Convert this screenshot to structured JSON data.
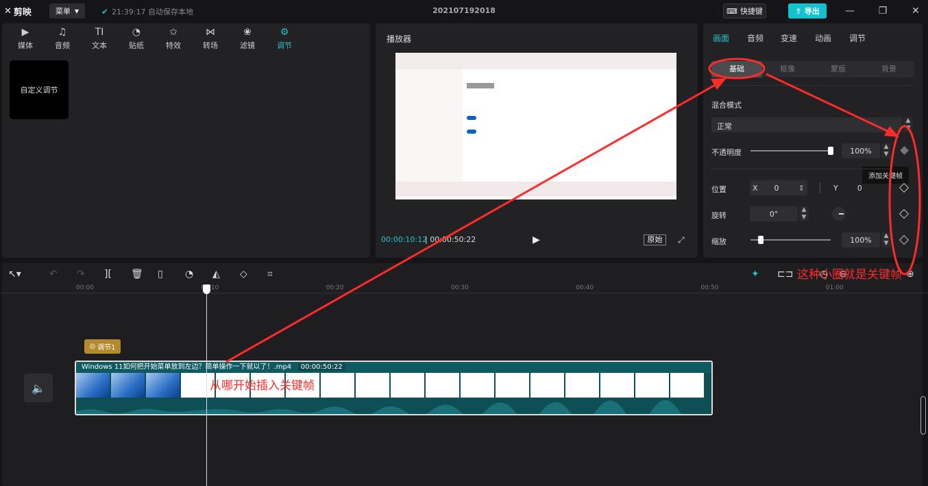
{
  "app": {
    "name": "剪映",
    "menu_label": "菜单",
    "autosave": "21:39:17 自动保存本地",
    "project_title": "202107192018",
    "shortcut_label": "快捷键",
    "export_label": "导出",
    "accent": "#22c3d0"
  },
  "toolbar": {
    "items": [
      {
        "label": "媒体",
        "icon": "media-icon"
      },
      {
        "label": "音频",
        "icon": "audio-icon"
      },
      {
        "label": "文本",
        "icon": "text-icon"
      },
      {
        "label": "贴纸",
        "icon": "sticker-icon"
      },
      {
        "label": "特效",
        "icon": "effects-icon"
      },
      {
        "label": "转场",
        "icon": "transition-icon"
      },
      {
        "label": "滤镜",
        "icon": "filter-icon"
      },
      {
        "label": "调节",
        "icon": "adjust-icon"
      }
    ],
    "active": "调节"
  },
  "library": {
    "custom_adjust": "自定义调节"
  },
  "player": {
    "title": "播放器",
    "current_time": "00:00:10:12",
    "total_time": "00:00:50:22",
    "original_label": "原始"
  },
  "inspector": {
    "tabs": [
      "画面",
      "音频",
      "变速",
      "动画",
      "调节"
    ],
    "active_tab": "画面",
    "subtabs": [
      "基础",
      "抠像",
      "蒙版",
      "背景"
    ],
    "active_subtab": "基础",
    "blend_label": "混合模式",
    "blend_value": "正常",
    "opacity_label": "不透明度",
    "opacity_value": "100%",
    "opacity_level": 1.0,
    "position_label": "位置",
    "pos_x_label": "X",
    "pos_x": "0",
    "pos_y_label": "Y",
    "pos_y": "0",
    "rotate_label": "旋转",
    "rotate_value": "0°",
    "scale_label": "缩放",
    "scale_value": "100%",
    "scale_level": 0.1,
    "keyframe_tooltip": "添加关键帧"
  },
  "timeline": {
    "ruler": [
      "00:00",
      "00:10",
      "00:20",
      "00:30",
      "00:40",
      "00:50",
      "01:00"
    ],
    "adjust_chip": "调节1",
    "clip_name": "Windows 11如何把开始菜单放到左边？简单操作一下就以了！.mp4",
    "clip_duration": "00:00:50:22"
  },
  "annotations": {
    "keyframe_note": "这种小圈就是关键帧",
    "start_note": "从哪开始插入关键帧",
    "color": "#ff2a2a"
  }
}
